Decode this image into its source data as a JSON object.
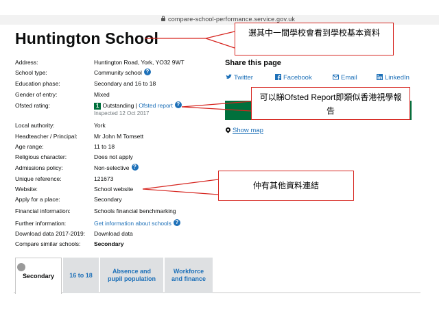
{
  "browser": {
    "url": "compare-school-performance.service.gov.uk"
  },
  "school": {
    "name": "Huntington School",
    "rows": [
      {
        "label": "Address:",
        "value": "Huntington Road, York, YO32 9WT"
      },
      {
        "label": "School type:",
        "value": "Community school"
      },
      {
        "label": "Education phase:",
        "value": "Secondary and 16 to 18"
      },
      {
        "label": "Gender of entry:",
        "value": "Mixed"
      },
      {
        "label": "Ofsted rating:",
        "rating_num": "1",
        "rating": "Outstanding",
        "sep": "|",
        "link": "Ofsted report",
        "inspected": "Inspected 12 Oct 2017"
      },
      {
        "label": "Local authority:",
        "value": "York"
      },
      {
        "label": "Headteacher / Principal:",
        "value": "Mr John M Tomsett"
      },
      {
        "label": "Age range:",
        "value": "11 to 18"
      },
      {
        "label": "Religious character:",
        "value": "Does not apply"
      },
      {
        "label": "Admissions policy:",
        "value": "Non-selective"
      },
      {
        "label": "Unique reference:",
        "value": "121673"
      },
      {
        "label": "Website:",
        "value": "School website"
      },
      {
        "label": "Apply for a place:",
        "value": "Secondary"
      },
      {
        "label": "Financial information:",
        "value": "Schools financial benchmarking"
      },
      {
        "label": "Further information:",
        "value": "Get information about schools"
      },
      {
        "label": "Download data 2017-2019:",
        "value": "Download data"
      },
      {
        "label": "Compare similar schools:",
        "value": "Secondary"
      }
    ]
  },
  "share": {
    "title": "Share this page",
    "twitter": "Twitter",
    "facebook": "Facebook",
    "email": "Email",
    "linkedin": "LinkedIn",
    "show_map": "Show map"
  },
  "callouts": {
    "c1": "選其中一間學校會看到學校基本資料",
    "c2": "可以睇Ofsted Report即類似香港視學報告",
    "c3": "仲有其他資料連結"
  },
  "tabs": [
    {
      "label": "Secondary"
    },
    {
      "label": "16 to 18"
    },
    {
      "label": "Absence and pupil population"
    },
    {
      "label": "Workforce and finance"
    }
  ],
  "colors": {
    "link": "#1d70b8",
    "green": "#00703c",
    "callout_border": "#d6251f"
  }
}
